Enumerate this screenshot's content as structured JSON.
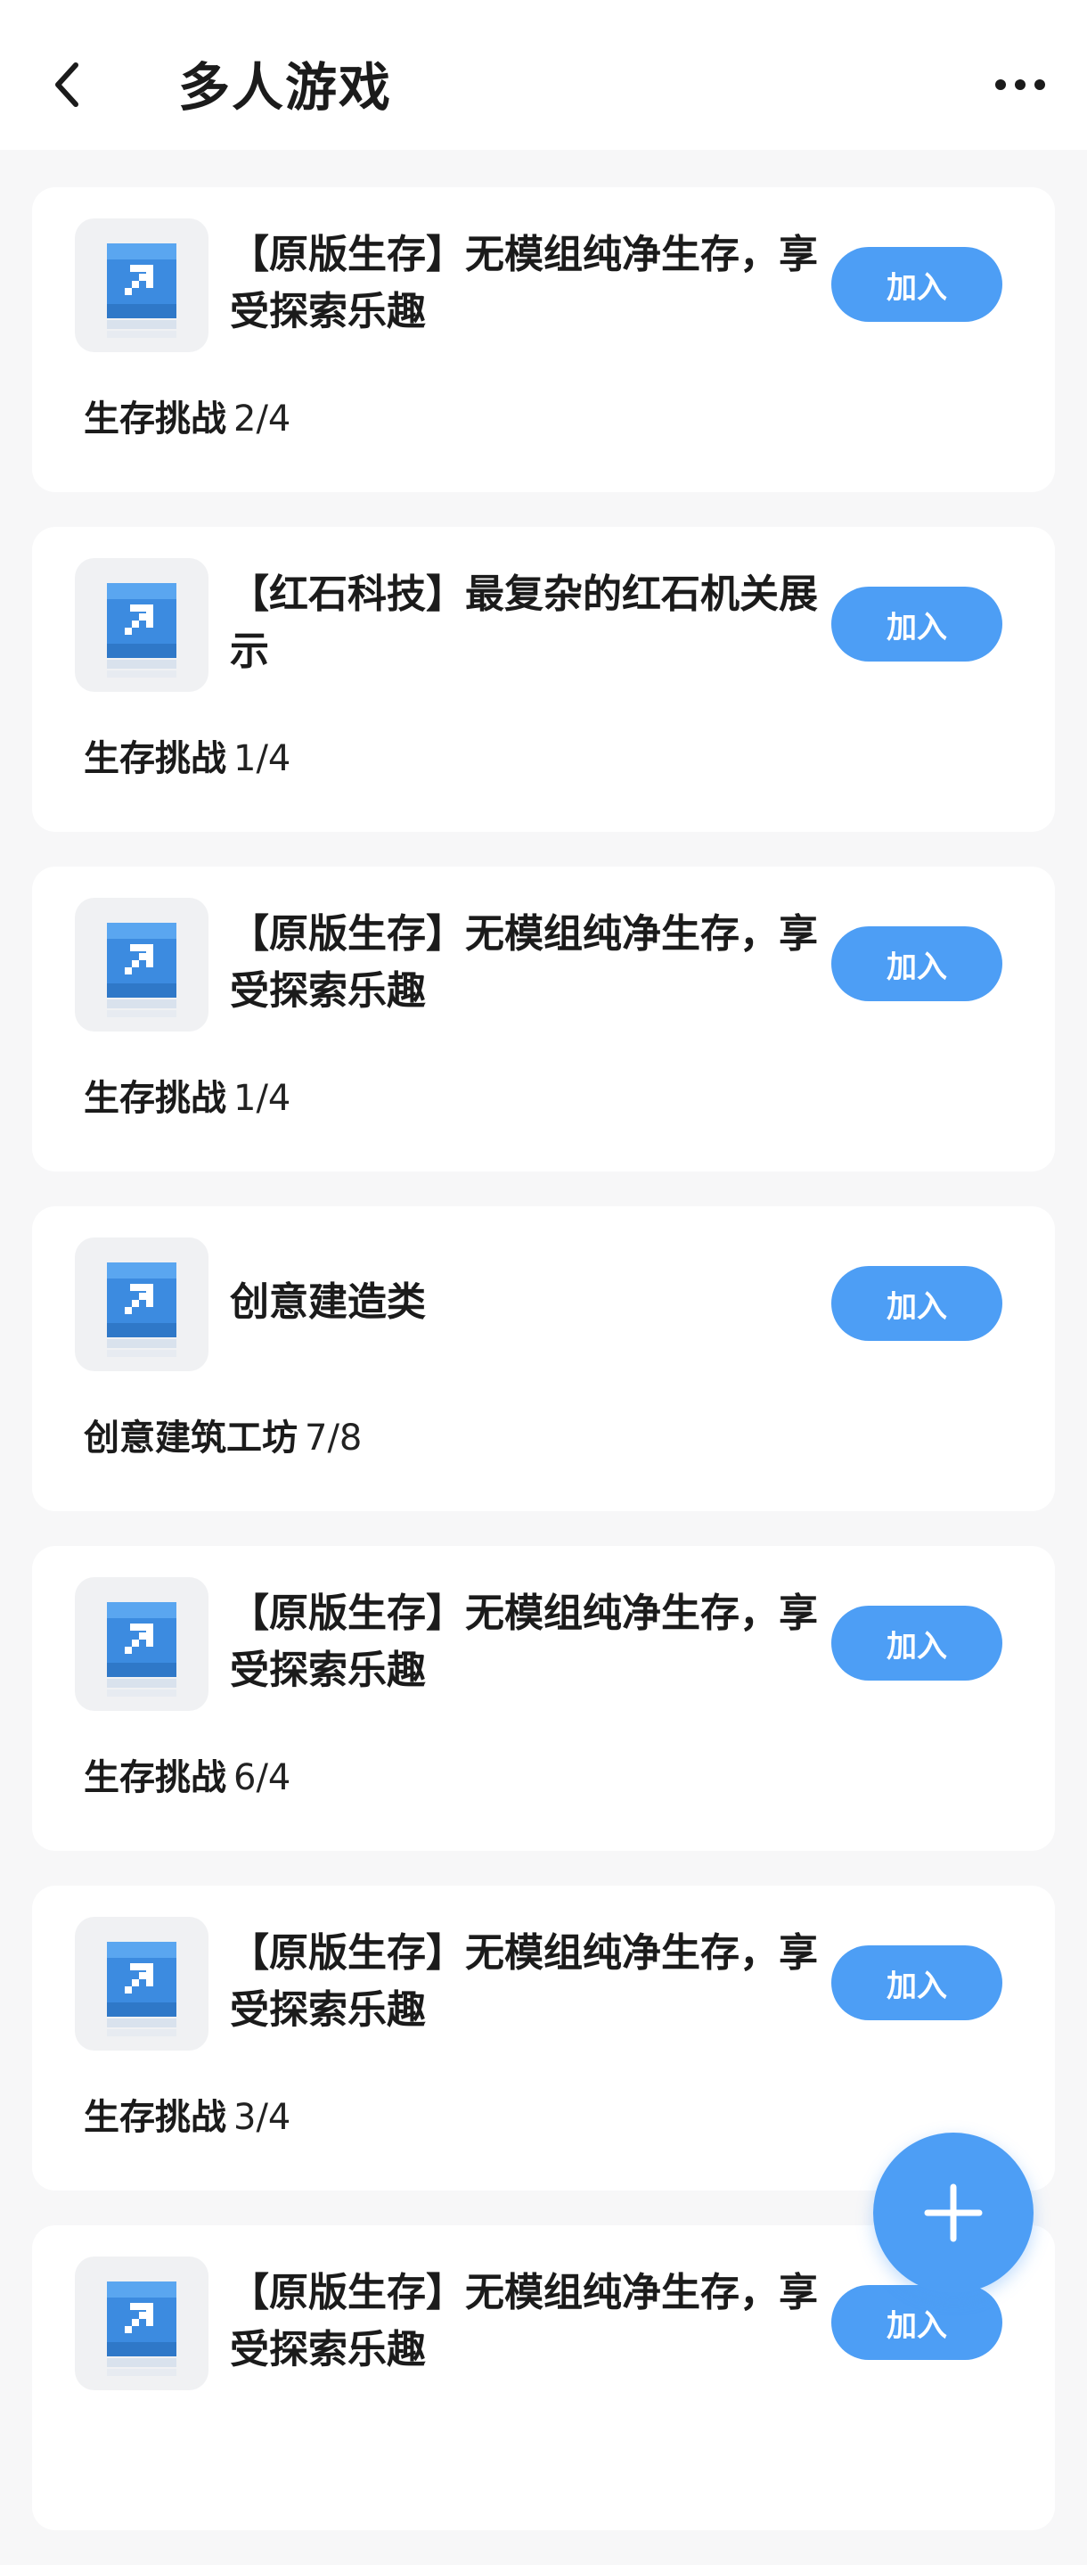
{
  "header": {
    "title": "多人游戏",
    "back_icon": "chevron-left-icon",
    "more_icon": "more-horizontal-icon"
  },
  "theme": {
    "accent": "#4d9ef5",
    "card_bg": "#ffffff",
    "page_bg": "#f7f7f8"
  },
  "rooms": [
    {
      "title": "【原版生存】无模组纯净生存，享受探索乐趣",
      "join_label": "加入",
      "mode": "生存挑战",
      "players": "2/4",
      "icon": "pickaxe-icon"
    },
    {
      "title": "【红石科技】最复杂的红石机关展示",
      "join_label": "加入",
      "mode": "生存挑战",
      "players": "1/4",
      "icon": "pickaxe-icon"
    },
    {
      "title": "【原版生存】无模组纯净生存，享受探索乐趣",
      "join_label": "加入",
      "mode": "生存挑战",
      "players": "1/4",
      "icon": "pickaxe-icon"
    },
    {
      "title": "创意建造类",
      "join_label": "加入",
      "mode": "创意建筑工坊",
      "players": "7/8",
      "icon": "pickaxe-icon"
    },
    {
      "title": "【原版生存】无模组纯净生存，享受探索乐趣",
      "join_label": "加入",
      "mode": "生存挑战",
      "players": "6/4",
      "icon": "pickaxe-icon"
    },
    {
      "title": "【原版生存】无模组纯净生存，享受探索乐趣",
      "join_label": "加入",
      "mode": "生存挑战",
      "players": "3/4",
      "icon": "pickaxe-icon"
    },
    {
      "title": "【原版生存】无模组纯净生存，享受探索乐趣",
      "join_label": "加入",
      "mode": "",
      "players": "",
      "icon": "pickaxe-icon"
    }
  ],
  "fab": {
    "icon": "plus-icon"
  }
}
